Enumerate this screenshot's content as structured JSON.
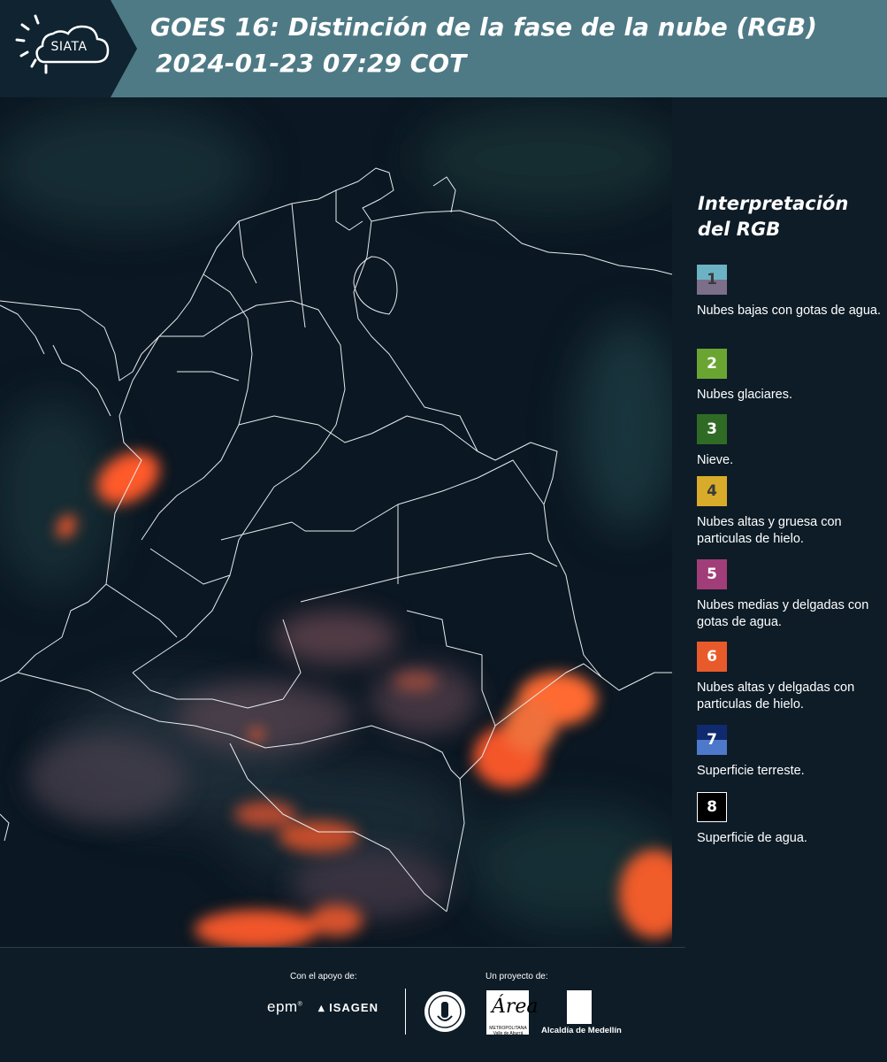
{
  "header": {
    "logo_text": "SIATA",
    "title_line1": "GOES 16: Distinción de la fase de la nube (RGB)",
    "title_line2": "2024-01-23 07:29 COT",
    "bg_color": "#4e7a86"
  },
  "legend": {
    "title": "Interpretación del RGB",
    "items": [
      {
        "number": "1",
        "label": "Nubes bajas con gotas de agua.",
        "color_top": "#6bb3c4",
        "color_bottom": "#7c6f8a",
        "text_color": "#3a3a3a"
      },
      {
        "number": "2",
        "label": "Nubes glaciares.",
        "color": "#6aa532",
        "text_color": "#ffffff"
      },
      {
        "number": "3",
        "label": "Nieve.",
        "color": "#2f6b25",
        "text_color": "#ffffff"
      },
      {
        "number": "4",
        "label": "Nubes altas y gruesa con particulas de hielo.",
        "color": "#d8ac2a",
        "text_color": "#3a3a3a"
      },
      {
        "number": "5",
        "label": "Nubes medias y delgadas con gotas de agua.",
        "color": "#a13d78",
        "text_color": "#ffffff"
      },
      {
        "number": "6",
        "label": "Nubes altas y delgadas con particulas de hielo.",
        "color": "#e95a2b",
        "text_color": "#ffffff"
      },
      {
        "number": "7",
        "label": "Superficie terreste.",
        "color_top": "#0f2a6e",
        "color_bottom": "#4e78c9",
        "text_color": "#ffffff"
      },
      {
        "number": "8",
        "label": "Superficie de agua.",
        "color": "#000000",
        "text_color": "#ffffff",
        "border": "#ffffff"
      }
    ]
  },
  "footer": {
    "support_label": "Con el apoyo de:",
    "project_label": "Un proyecto de:",
    "sponsor1": "epm",
    "sponsor2": "ISAGEN",
    "partner_area": "Área",
    "partner_area_sub": "METROPOLITANA Valle de Aburrá",
    "partner_alcaldia": "Alcaldía de Medellín"
  }
}
